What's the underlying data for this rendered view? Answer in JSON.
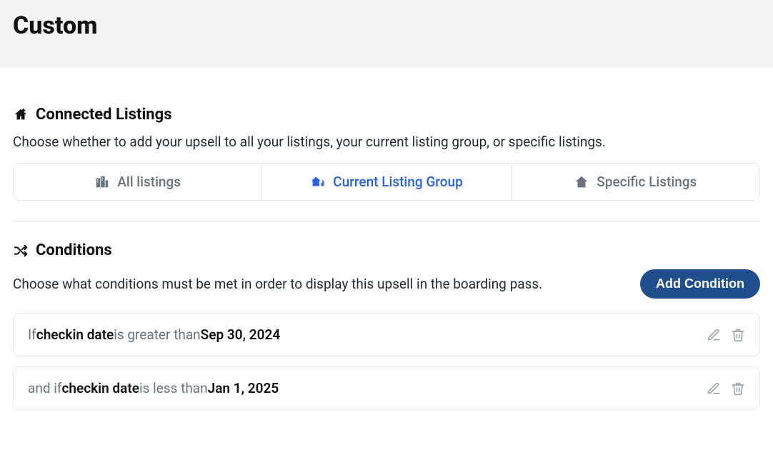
{
  "header": {
    "title": "Custom"
  },
  "sections": {
    "connected": {
      "title": "Connected Listings",
      "description": "Choose whether to add your upsell to all your listings, your current listing group, or specific listings.",
      "tabs": {
        "all": "All listings",
        "current": "Current Listing Group",
        "specific": "Specific Listings"
      }
    },
    "conditions": {
      "title": "Conditions",
      "description": "Choose what conditions must be met in order to display this upsell in the boarding pass.",
      "add_button": "Add Condition",
      "rows": [
        {
          "prefix": "If ",
          "field": "checkin date",
          "operator": " is greater than ",
          "value": "Sep 30, 2024"
        },
        {
          "prefix": "and if ",
          "field": "checkin date",
          "operator": " is less than ",
          "value": "Jan 1, 2025"
        }
      ]
    }
  }
}
